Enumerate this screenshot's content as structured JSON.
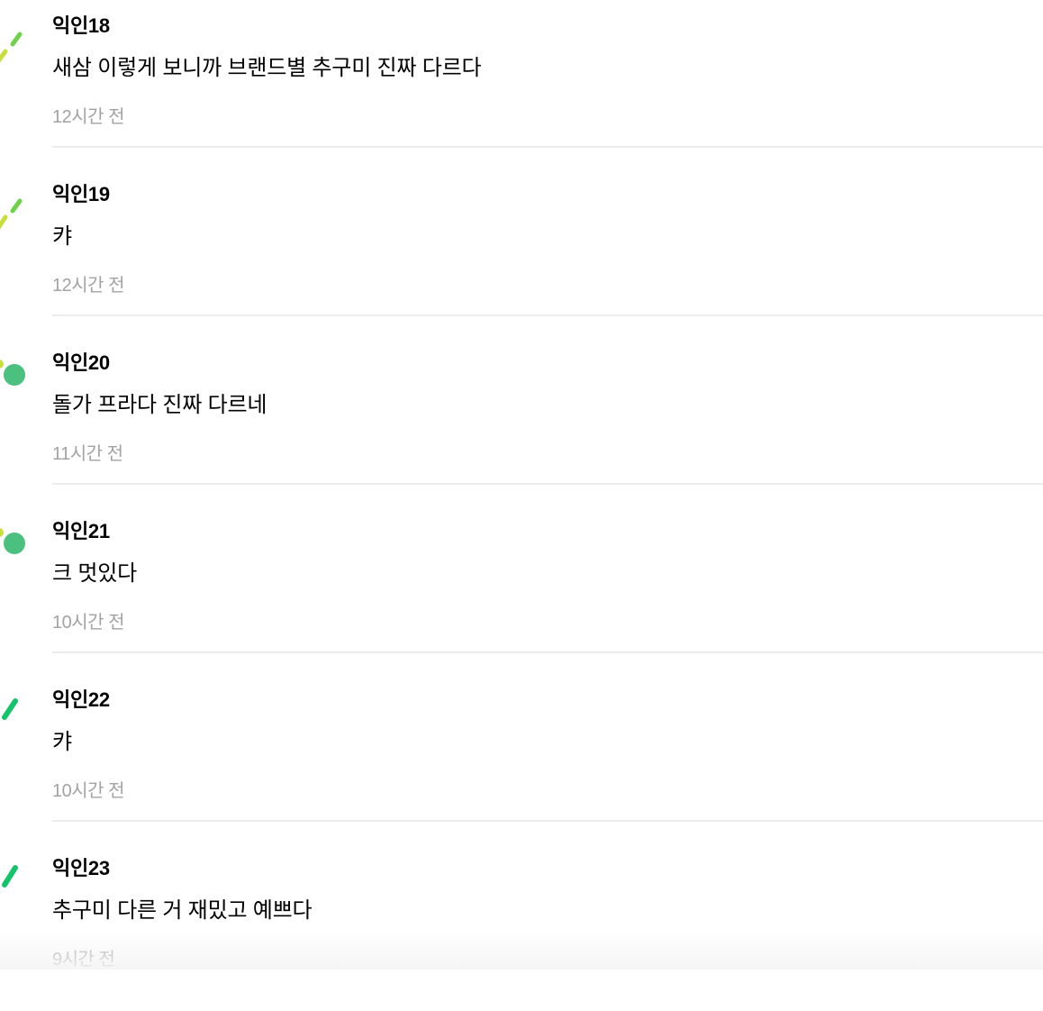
{
  "comments": [
    {
      "author": "익인18",
      "text": "새삼 이렇게 보니까 브랜드별 추구미 진짜 다르다",
      "time": "12시간 전",
      "avatar": "stroke-lime"
    },
    {
      "author": "익인19",
      "text": "캬",
      "time": "12시간 전",
      "avatar": "stroke-lime"
    },
    {
      "author": "익인20",
      "text": "돌가 프라다 진짜 다르네",
      "time": "11시간 전",
      "avatar": "dot-green"
    },
    {
      "author": "익인21",
      "text": "크 멋있다",
      "time": "10시간 전",
      "avatar": "dot-green"
    },
    {
      "author": "익인22",
      "text": "캬",
      "time": "10시간 전",
      "avatar": "stroke-green"
    },
    {
      "author": "익인23",
      "text": "추구미 다른 거 재밌고 예쁘다",
      "time": "9시간 전",
      "avatar": "stroke-green"
    }
  ],
  "colors": {
    "lime": "#c8de3c",
    "lightgreen": "#6fd24a",
    "green": "#13c46a",
    "teal": "#4cc07e",
    "divider": "#ececec",
    "time": "#a3a3a3"
  }
}
